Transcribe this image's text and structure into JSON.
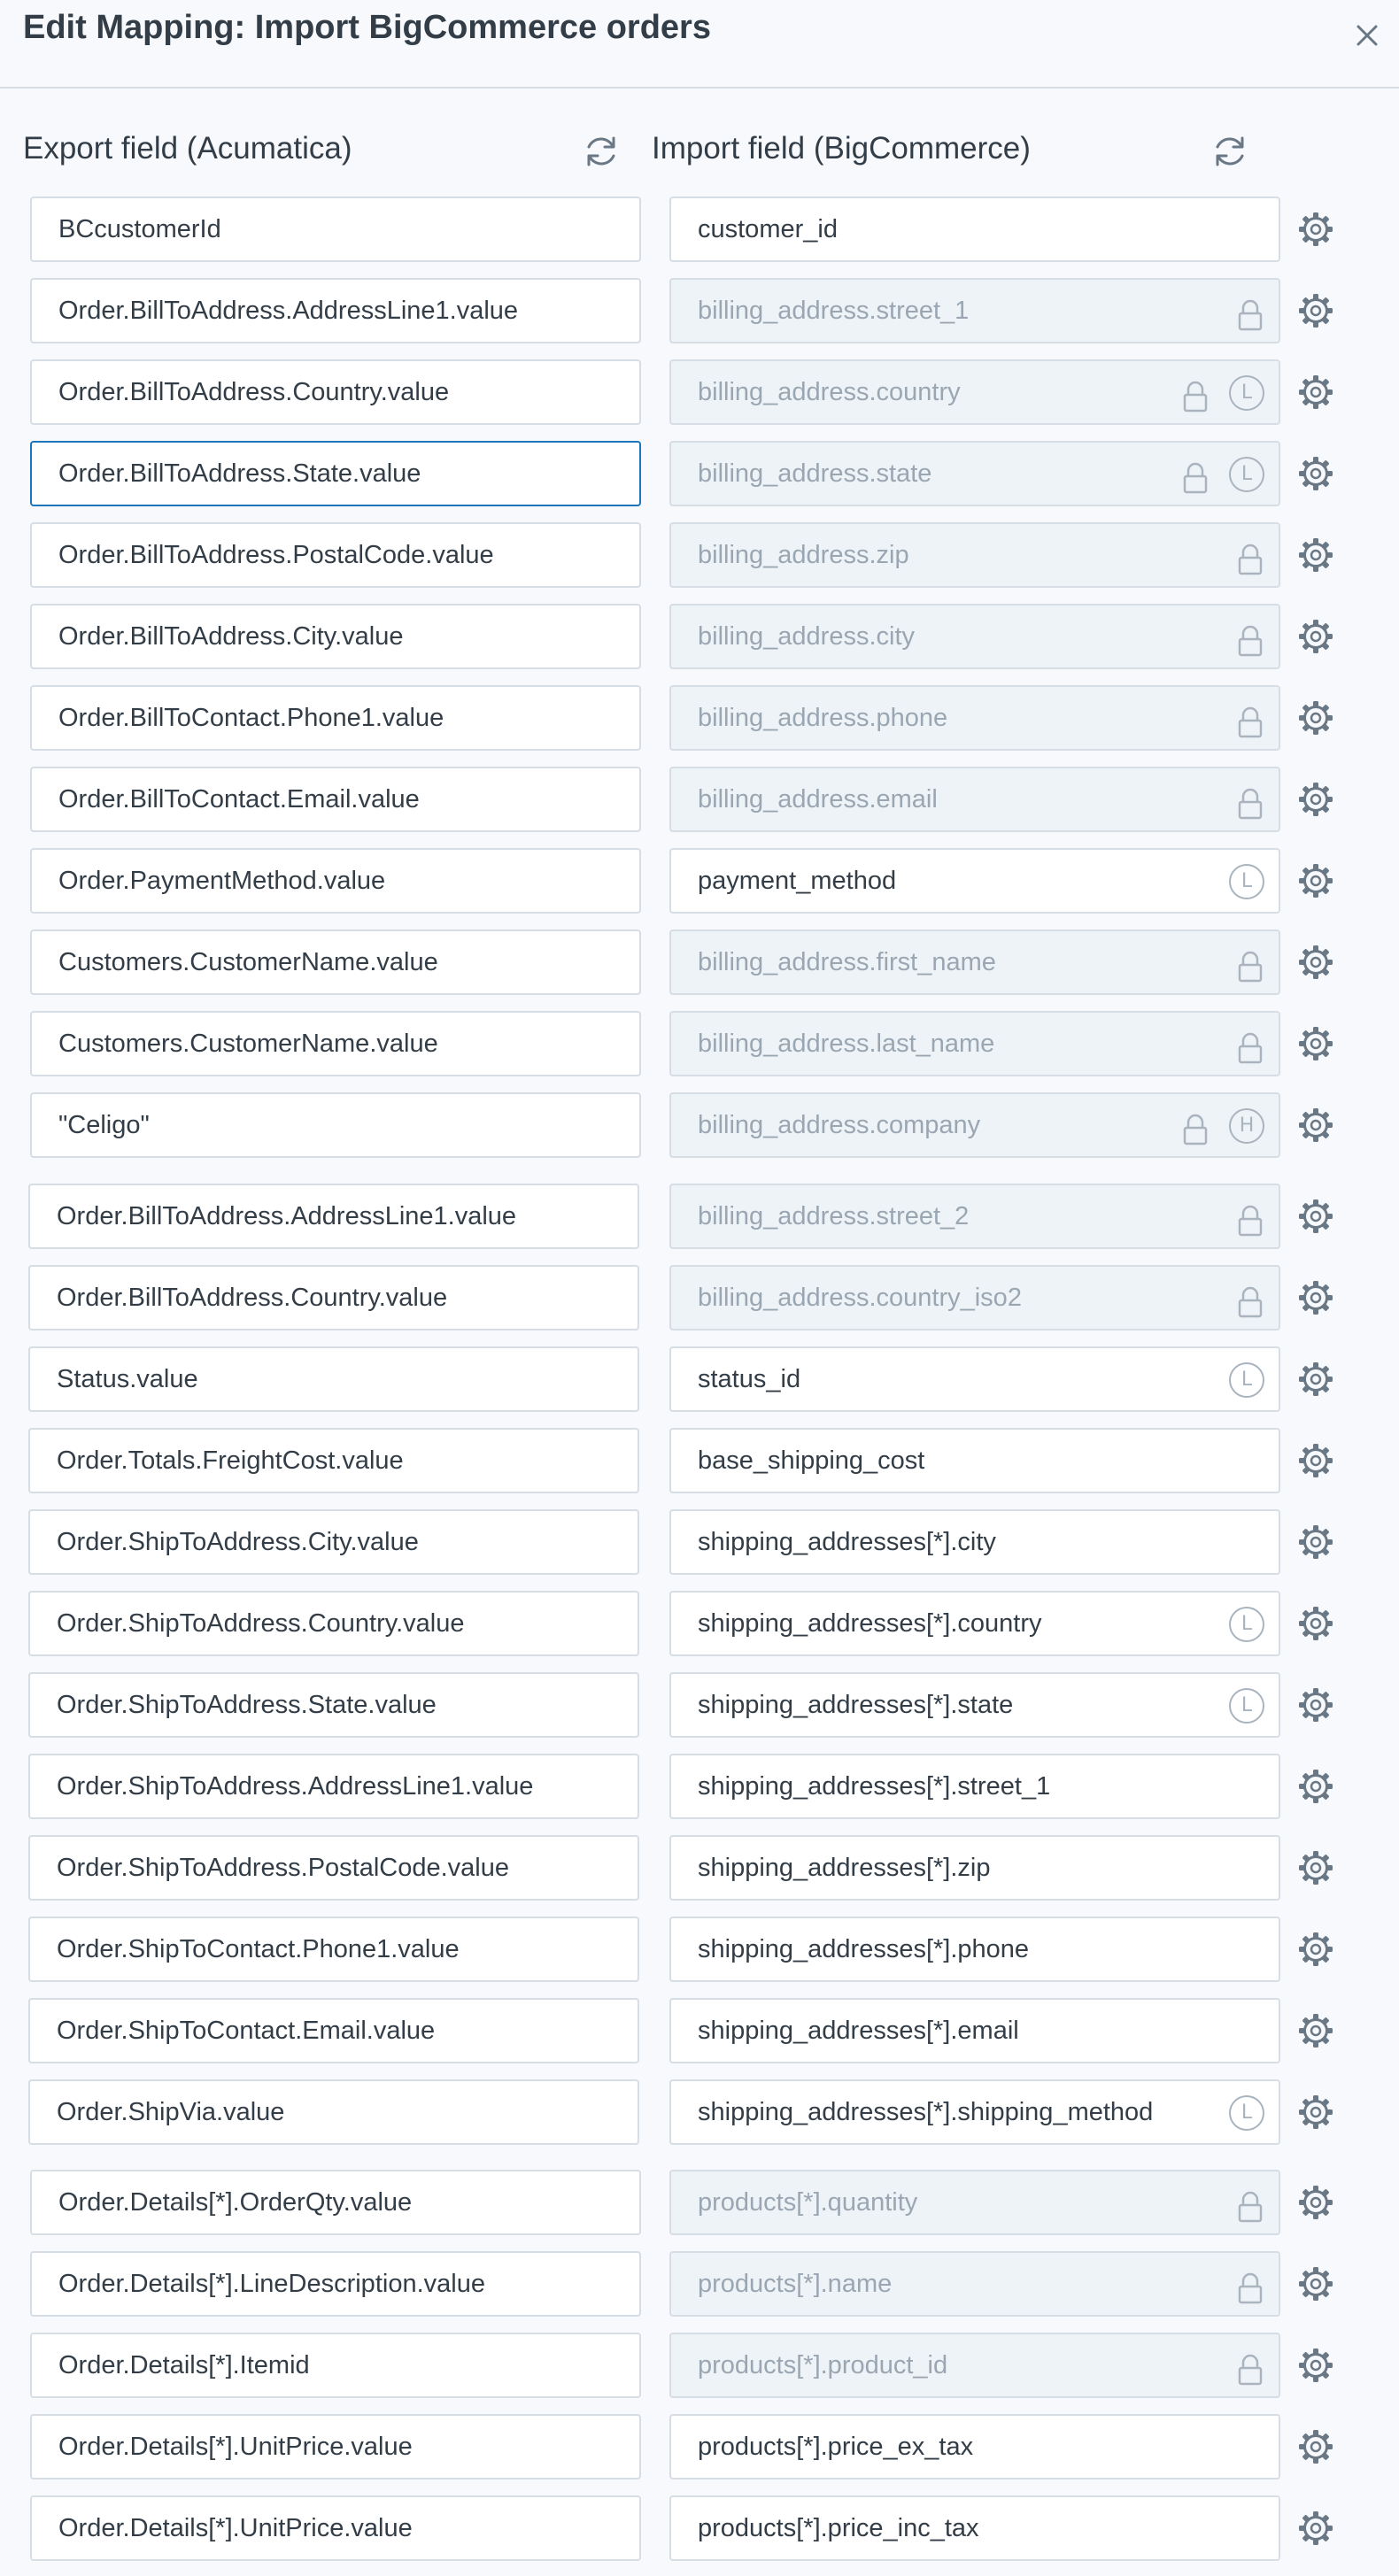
{
  "dialog": {
    "title": "Edit Mapping: Import BigCommerce orders"
  },
  "columns": {
    "export_header": "Export field (Acumatica)",
    "import_header": "Import field (BigCommerce)"
  },
  "colors": {
    "focus_border": "#1d76ba",
    "locked_background": "#eef3f7",
    "locked_text": "#9aa6b2",
    "icon": "#6a7886"
  },
  "mappings": [
    {
      "export": "BCcustomerId",
      "import": "customer_id",
      "locked": false,
      "lock_icon": false,
      "badge": ""
    },
    {
      "export": "Order.BillToAddress.AddressLine1.value",
      "import": "billing_address.street_1",
      "locked": true,
      "lock_icon": true,
      "badge": ""
    },
    {
      "export": "Order.BillToAddress.Country.value",
      "import": "billing_address.country",
      "locked": true,
      "lock_icon": true,
      "badge": "L"
    },
    {
      "export": "Order.BillToAddress.State.value",
      "import": "billing_address.state",
      "locked": true,
      "lock_icon": true,
      "badge": "L",
      "focused": true
    },
    {
      "export": "Order.BillToAddress.PostalCode.value",
      "import": "billing_address.zip",
      "locked": true,
      "lock_icon": true,
      "badge": ""
    },
    {
      "export": "Order.BillToAddress.City.value",
      "import": "billing_address.city",
      "locked": true,
      "lock_icon": true,
      "badge": ""
    },
    {
      "export": "Order.BillToContact.Phone1.value",
      "import": "billing_address.phone",
      "locked": true,
      "lock_icon": true,
      "badge": ""
    },
    {
      "export": "Order.BillToContact.Email.value",
      "import": "billing_address.email",
      "locked": true,
      "lock_icon": true,
      "badge": ""
    },
    {
      "export": "Order.PaymentMethod.value",
      "import": "payment_method",
      "locked": false,
      "lock_icon": false,
      "badge": "L"
    },
    {
      "export": "Customers.CustomerName.value",
      "import": "billing_address.first_name",
      "locked": true,
      "lock_icon": true,
      "badge": ""
    },
    {
      "export": "Customers.CustomerName.value",
      "import": "billing_address.last_name",
      "locked": true,
      "lock_icon": true,
      "badge": ""
    },
    {
      "export": "\"Celigo\"",
      "import": "billing_address.company",
      "locked": true,
      "lock_icon": true,
      "badge": "H"
    },
    {
      "export": "Order.BillToAddress.AddressLine1.value",
      "import": "billing_address.street_2",
      "locked": true,
      "lock_icon": true,
      "badge": ""
    },
    {
      "export": "Order.BillToAddress.Country.value",
      "import": "billing_address.country_iso2",
      "locked": true,
      "lock_icon": true,
      "badge": ""
    },
    {
      "export": "Status.value",
      "import": "status_id",
      "locked": false,
      "lock_icon": false,
      "badge": "L"
    },
    {
      "export": "Order.Totals.FreightCost.value",
      "import": "base_shipping_cost",
      "locked": false,
      "lock_icon": false,
      "badge": ""
    },
    {
      "export": "Order.ShipToAddress.City.value",
      "import": "shipping_addresses[*].city",
      "locked": false,
      "lock_icon": false,
      "badge": ""
    },
    {
      "export": "Order.ShipToAddress.Country.value",
      "import": "shipping_addresses[*].country",
      "locked": false,
      "lock_icon": false,
      "badge": "L"
    },
    {
      "export": "Order.ShipToAddress.State.value",
      "import": "shipping_addresses[*].state",
      "locked": false,
      "lock_icon": false,
      "badge": "L"
    },
    {
      "export": "Order.ShipToAddress.AddressLine1.value",
      "import": "shipping_addresses[*].street_1",
      "locked": false,
      "lock_icon": false,
      "badge": ""
    },
    {
      "export": "Order.ShipToAddress.PostalCode.value",
      "import": "shipping_addresses[*].zip",
      "locked": false,
      "lock_icon": false,
      "badge": ""
    },
    {
      "export": "Order.ShipToContact.Phone1.value",
      "import": "shipping_addresses[*].phone",
      "locked": false,
      "lock_icon": false,
      "badge": ""
    },
    {
      "export": "Order.ShipToContact.Email.value",
      "import": "shipping_addresses[*].email",
      "locked": false,
      "lock_icon": false,
      "badge": ""
    },
    {
      "export": "Order.ShipVia.value",
      "import": "shipping_addresses[*].shipping_method",
      "locked": false,
      "lock_icon": false,
      "badge": "L"
    },
    {
      "export": "Order.Details[*].OrderQty.value",
      "import": "products[*].quantity",
      "locked": true,
      "lock_icon": true,
      "badge": ""
    },
    {
      "export": "Order.Details[*].LineDescription.value",
      "import": "products[*].name",
      "locked": true,
      "lock_icon": true,
      "badge": ""
    },
    {
      "export": "Order.Details[*].Itemid",
      "import": "products[*].product_id",
      "locked": true,
      "lock_icon": true,
      "badge": ""
    },
    {
      "export": "Order.Details[*].UnitPrice.value",
      "import": "products[*].price_ex_tax",
      "locked": false,
      "lock_icon": false,
      "badge": ""
    },
    {
      "export": "Order.Details[*].UnitPrice.value",
      "import": "products[*].price_inc_tax",
      "locked": false,
      "lock_icon": false,
      "badge": ""
    }
  ]
}
